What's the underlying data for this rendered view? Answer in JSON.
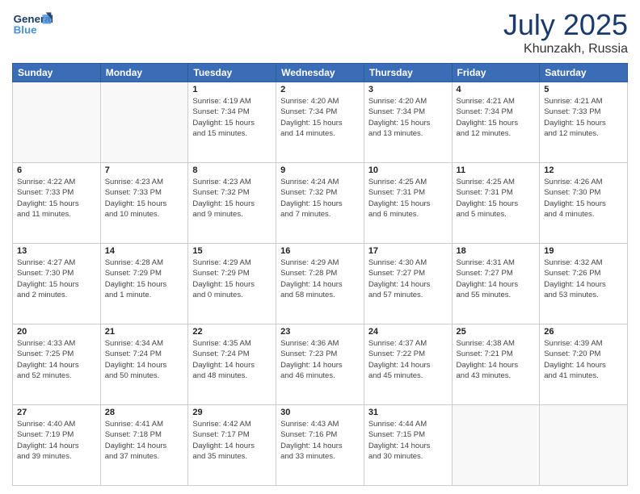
{
  "header": {
    "logo_text": "General Blue",
    "month": "July 2025",
    "location": "Khunzakh, Russia"
  },
  "weekdays": [
    "Sunday",
    "Monday",
    "Tuesday",
    "Wednesday",
    "Thursday",
    "Friday",
    "Saturday"
  ],
  "weeks": [
    [
      {
        "day": "",
        "info": ""
      },
      {
        "day": "",
        "info": ""
      },
      {
        "day": "1",
        "info": "Sunrise: 4:19 AM\nSunset: 7:34 PM\nDaylight: 15 hours\nand 15 minutes."
      },
      {
        "day": "2",
        "info": "Sunrise: 4:20 AM\nSunset: 7:34 PM\nDaylight: 15 hours\nand 14 minutes."
      },
      {
        "day": "3",
        "info": "Sunrise: 4:20 AM\nSunset: 7:34 PM\nDaylight: 15 hours\nand 13 minutes."
      },
      {
        "day": "4",
        "info": "Sunrise: 4:21 AM\nSunset: 7:34 PM\nDaylight: 15 hours\nand 12 minutes."
      },
      {
        "day": "5",
        "info": "Sunrise: 4:21 AM\nSunset: 7:33 PM\nDaylight: 15 hours\nand 12 minutes."
      }
    ],
    [
      {
        "day": "6",
        "info": "Sunrise: 4:22 AM\nSunset: 7:33 PM\nDaylight: 15 hours\nand 11 minutes."
      },
      {
        "day": "7",
        "info": "Sunrise: 4:23 AM\nSunset: 7:33 PM\nDaylight: 15 hours\nand 10 minutes."
      },
      {
        "day": "8",
        "info": "Sunrise: 4:23 AM\nSunset: 7:32 PM\nDaylight: 15 hours\nand 9 minutes."
      },
      {
        "day": "9",
        "info": "Sunrise: 4:24 AM\nSunset: 7:32 PM\nDaylight: 15 hours\nand 7 minutes."
      },
      {
        "day": "10",
        "info": "Sunrise: 4:25 AM\nSunset: 7:31 PM\nDaylight: 15 hours\nand 6 minutes."
      },
      {
        "day": "11",
        "info": "Sunrise: 4:25 AM\nSunset: 7:31 PM\nDaylight: 15 hours\nand 5 minutes."
      },
      {
        "day": "12",
        "info": "Sunrise: 4:26 AM\nSunset: 7:30 PM\nDaylight: 15 hours\nand 4 minutes."
      }
    ],
    [
      {
        "day": "13",
        "info": "Sunrise: 4:27 AM\nSunset: 7:30 PM\nDaylight: 15 hours\nand 2 minutes."
      },
      {
        "day": "14",
        "info": "Sunrise: 4:28 AM\nSunset: 7:29 PM\nDaylight: 15 hours\nand 1 minute."
      },
      {
        "day": "15",
        "info": "Sunrise: 4:29 AM\nSunset: 7:29 PM\nDaylight: 15 hours\nand 0 minutes."
      },
      {
        "day": "16",
        "info": "Sunrise: 4:29 AM\nSunset: 7:28 PM\nDaylight: 14 hours\nand 58 minutes."
      },
      {
        "day": "17",
        "info": "Sunrise: 4:30 AM\nSunset: 7:27 PM\nDaylight: 14 hours\nand 57 minutes."
      },
      {
        "day": "18",
        "info": "Sunrise: 4:31 AM\nSunset: 7:27 PM\nDaylight: 14 hours\nand 55 minutes."
      },
      {
        "day": "19",
        "info": "Sunrise: 4:32 AM\nSunset: 7:26 PM\nDaylight: 14 hours\nand 53 minutes."
      }
    ],
    [
      {
        "day": "20",
        "info": "Sunrise: 4:33 AM\nSunset: 7:25 PM\nDaylight: 14 hours\nand 52 minutes."
      },
      {
        "day": "21",
        "info": "Sunrise: 4:34 AM\nSunset: 7:24 PM\nDaylight: 14 hours\nand 50 minutes."
      },
      {
        "day": "22",
        "info": "Sunrise: 4:35 AM\nSunset: 7:24 PM\nDaylight: 14 hours\nand 48 minutes."
      },
      {
        "day": "23",
        "info": "Sunrise: 4:36 AM\nSunset: 7:23 PM\nDaylight: 14 hours\nand 46 minutes."
      },
      {
        "day": "24",
        "info": "Sunrise: 4:37 AM\nSunset: 7:22 PM\nDaylight: 14 hours\nand 45 minutes."
      },
      {
        "day": "25",
        "info": "Sunrise: 4:38 AM\nSunset: 7:21 PM\nDaylight: 14 hours\nand 43 minutes."
      },
      {
        "day": "26",
        "info": "Sunrise: 4:39 AM\nSunset: 7:20 PM\nDaylight: 14 hours\nand 41 minutes."
      }
    ],
    [
      {
        "day": "27",
        "info": "Sunrise: 4:40 AM\nSunset: 7:19 PM\nDaylight: 14 hours\nand 39 minutes."
      },
      {
        "day": "28",
        "info": "Sunrise: 4:41 AM\nSunset: 7:18 PM\nDaylight: 14 hours\nand 37 minutes."
      },
      {
        "day": "29",
        "info": "Sunrise: 4:42 AM\nSunset: 7:17 PM\nDaylight: 14 hours\nand 35 minutes."
      },
      {
        "day": "30",
        "info": "Sunrise: 4:43 AM\nSunset: 7:16 PM\nDaylight: 14 hours\nand 33 minutes."
      },
      {
        "day": "31",
        "info": "Sunrise: 4:44 AM\nSunset: 7:15 PM\nDaylight: 14 hours\nand 30 minutes."
      },
      {
        "day": "",
        "info": ""
      },
      {
        "day": "",
        "info": ""
      }
    ]
  ]
}
